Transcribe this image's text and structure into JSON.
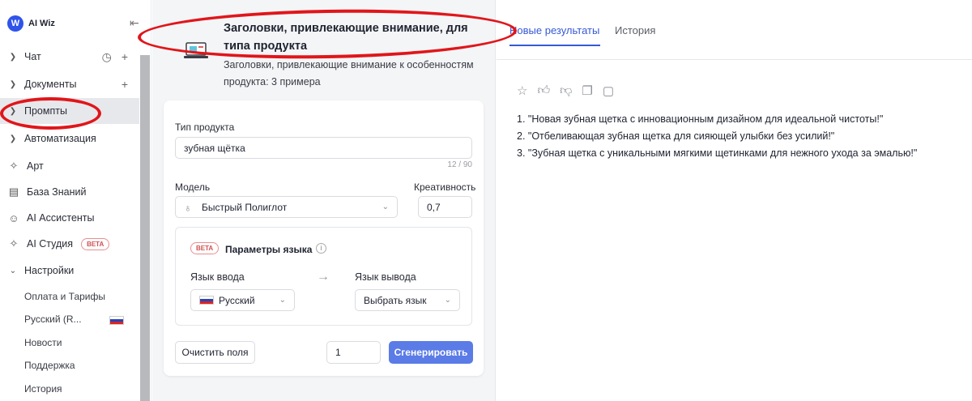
{
  "sidebar": {
    "logo_letter": "W",
    "app_name": "AI Wiz",
    "items": [
      {
        "label": "Чат"
      },
      {
        "label": "Документы"
      },
      {
        "label": "Промпты"
      },
      {
        "label": "Автоматизация"
      },
      {
        "label": "Арт"
      },
      {
        "label": "База Знаний"
      },
      {
        "label": "AI Ассистенты"
      },
      {
        "label": "AI Студия",
        "badge": "BETA"
      },
      {
        "label": "Настройки"
      }
    ],
    "settings_sub": [
      {
        "label": "Оплата и Тарифы"
      },
      {
        "label": "Русский (R..."
      },
      {
        "label": "Новости"
      },
      {
        "label": "Поддержка"
      },
      {
        "label": "История"
      }
    ]
  },
  "header": {
    "title": "Заголовки, привлекающие внимание, для типа продукта",
    "subtitle": "Заголовки, привлекающие внимание к особенностям продукта: 3 примера"
  },
  "form": {
    "product_type_label": "Тип продукта",
    "product_type_value": "зубная щётка",
    "counter": "12 / 90",
    "model_label": "Модель",
    "model_value": "Быстрый Полиглот",
    "creativity_label": "Креативность",
    "creativity_value": "0,7",
    "lang_badge": "BETA",
    "lang_title": "Параметры языка",
    "input_lang_label": "Язык ввода",
    "input_lang_value": "Русский",
    "output_lang_label": "Язык вывода",
    "output_lang_value": "Выбрать язык",
    "clear_button": "Очистить поля",
    "count_value": "1",
    "generate_button": "Сгенерировать"
  },
  "results": {
    "tabs": [
      "Новые результаты",
      "История"
    ],
    "items": [
      "1. \"Новая зубная щетка с инновационным дизайном для идеальной чистоты!\"",
      "2. \"Отбеливающая зубная щетка для сияющей улыбки без усилий!\"",
      "3. \"Зубная щетка с уникальными мягкими щетинками для нежного ухода за эмалью!\""
    ]
  },
  "colors": {
    "accent": "#3659d6",
    "generate_button": "#5b7be6",
    "annotation": "#e0161a",
    "beta": "#d05050"
  }
}
